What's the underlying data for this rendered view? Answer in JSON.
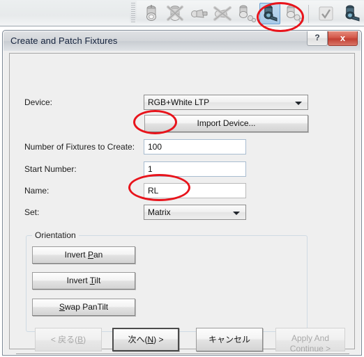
{
  "toolbar": {
    "buttons": [
      {
        "name": "patch-fixture-icon",
        "label": "Patch Fixture",
        "selected": false
      },
      {
        "name": "unpatch-fixture-icon",
        "label": "Unpatch Fixture",
        "selected": false
      },
      {
        "name": "patch-device-icon",
        "label": "Patch Device",
        "selected": false
      },
      {
        "name": "unpatch-device-icon",
        "label": "Unpatch Device",
        "selected": false
      },
      {
        "name": "edit-fixture-icon",
        "label": "Edit Fixture",
        "selected": false
      },
      {
        "name": "create-and-patch-fixtures-icon",
        "label": "Create and Patch Fixtures",
        "selected": true
      },
      {
        "name": "fixture-settings-icon",
        "label": "Fixture Settings",
        "selected": false
      },
      {
        "name": "confirm-check-icon",
        "label": "Confirm",
        "selected": false
      },
      {
        "name": "fixture-extra-icon",
        "label": "Fixture",
        "selected": false
      }
    ]
  },
  "dialog": {
    "title": "Create and Patch Fixtures",
    "help_label": "?",
    "close_label": "x"
  },
  "form": {
    "device": {
      "label": "Device:",
      "value": "RGB+White LTP",
      "options": [
        "RGB+White LTP"
      ]
    },
    "import_device_button": "Import Device...",
    "number_of_fixtures": {
      "label": "Number of Fixtures to Create:",
      "value": "100"
    },
    "start_number": {
      "label": "Start Number:",
      "value": "1"
    },
    "name": {
      "label": "Name:",
      "value": "RL"
    },
    "set": {
      "label": "Set:",
      "value": "Matrix",
      "options": [
        "Matrix"
      ]
    }
  },
  "orientation": {
    "legend": "Orientation",
    "buttons": [
      {
        "pre": "Invert ",
        "accel": "P",
        "post": "an"
      },
      {
        "pre": "Invert ",
        "accel": "T",
        "post": "ilt"
      },
      {
        "pre": "",
        "accel": "S",
        "post": "wap PanTilt"
      }
    ]
  },
  "footer": {
    "back": {
      "pre": "< 戻る(",
      "accel": "B",
      "post": ")",
      "disabled": true
    },
    "next": {
      "pre": "次へ(",
      "accel": "N",
      "post": ") >",
      "disabled": false,
      "focused": true
    },
    "cancel": {
      "pre": "キャンセル",
      "accel": "",
      "post": "",
      "disabled": false
    },
    "apply_and_continue": {
      "line1": "Apply And",
      "line2": "Continue >",
      "disabled": true
    }
  },
  "annotations": {
    "color": "#e8141c",
    "targets": [
      "create-and-patch-fixtures-icon",
      "number-of-fixtures-input",
      "set-combo"
    ]
  }
}
